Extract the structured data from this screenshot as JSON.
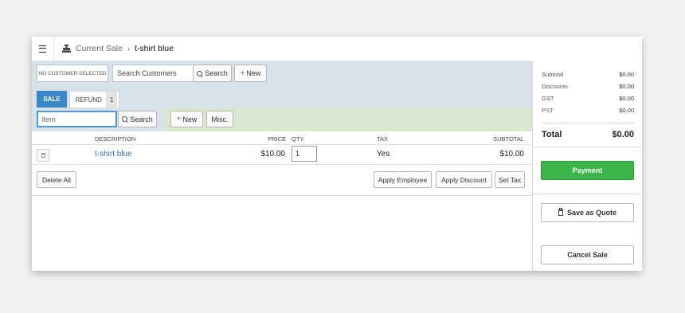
{
  "header": {
    "breadcrumb_current": "Current Sale",
    "breadcrumb_item": "t-shirt blue",
    "separator": "›"
  },
  "customer": {
    "no_customer_label": "NO CUSTOMER SELECTED",
    "search_placeholder": "Search Customers",
    "search_button": "Search",
    "new_button": "New"
  },
  "tabs": {
    "sale": "SALE",
    "refund": "REFUND",
    "refund_count": "1"
  },
  "item_bar": {
    "item_placeholder": "Item",
    "search_button": "Search",
    "new_button": "New",
    "misc_button": "Misc."
  },
  "table": {
    "headers": {
      "description": "DESCRIPTION",
      "price": "PRICE",
      "qty": "QTY.",
      "tax": "TAX",
      "subtotal": "SUBTOTAL"
    },
    "rows": [
      {
        "description": "t-shirt blue",
        "price": "$10.00",
        "qty": "1",
        "tax": "Yes",
        "subtotal": "$10.00"
      }
    ]
  },
  "actions": {
    "delete_all": "Delete All",
    "apply_employee": "Apply Employee",
    "apply_discount": "Apply Discount",
    "set_tax": "Set Tax"
  },
  "summary": {
    "subtotal_label": "Subtotal",
    "subtotal": "$0.00",
    "discounts_label": "Discounts",
    "discounts": "$0.00",
    "gst_label": "GST",
    "gst": "$0.00",
    "pst_label": "PST",
    "pst": "$0.00",
    "total_label": "Total",
    "total": "$0.00"
  },
  "buttons": {
    "payment": "Payment",
    "save_quote": "Save as Quote",
    "cancel_sale": "Cancel Sale"
  },
  "colors": {
    "accent_blue": "#3c87c9",
    "payment_green": "#3bb54a",
    "link_blue": "#2e6fb0",
    "customer_bar": "#d7e1ea",
    "item_bar": "#d8e6cf"
  }
}
